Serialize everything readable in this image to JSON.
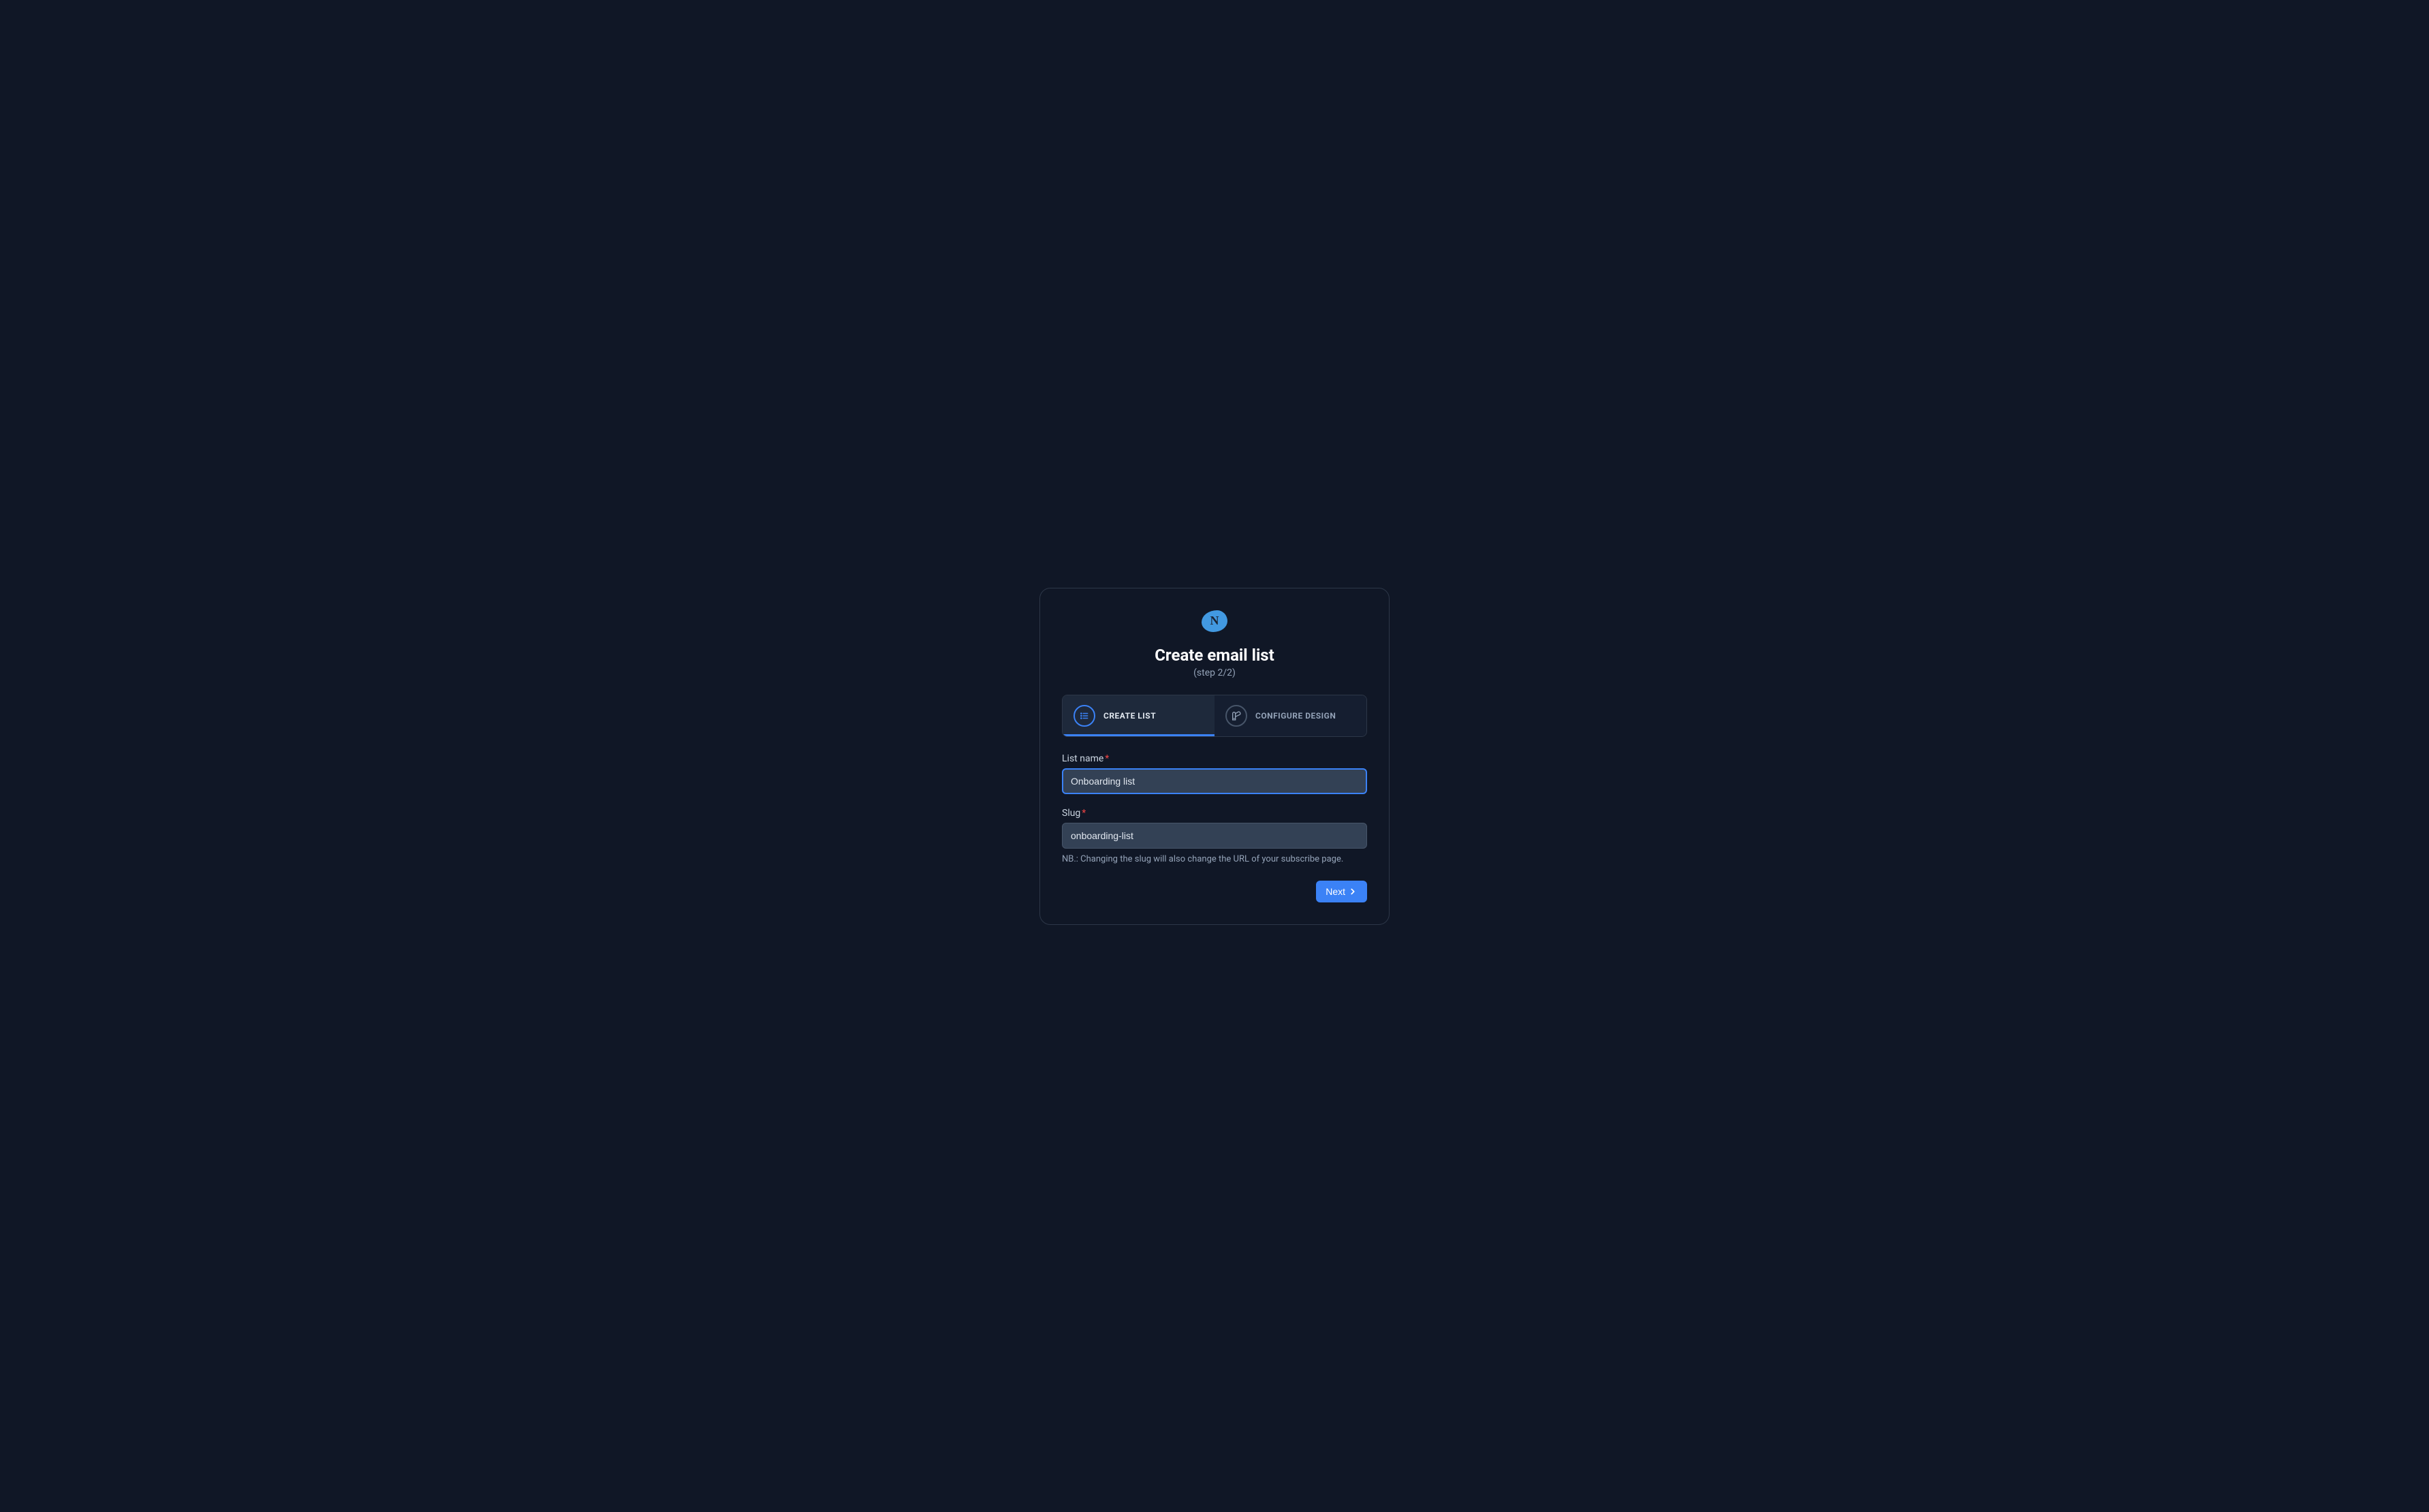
{
  "logo": {
    "letter": "N"
  },
  "header": {
    "title": "Create email list",
    "subtitle": "(step 2/2)"
  },
  "tabs": {
    "createList": "CREATE LIST",
    "configureDesign": "CONFIGURE DESIGN"
  },
  "form": {
    "listName": {
      "label": "List name",
      "value": "Onboarding list",
      "required": true
    },
    "slug": {
      "label": "Slug",
      "value": "onboarding-list",
      "required": true,
      "helper": "NB.: Changing the slug will also change the URL of your subscribe page."
    }
  },
  "buttons": {
    "next": "Next"
  }
}
